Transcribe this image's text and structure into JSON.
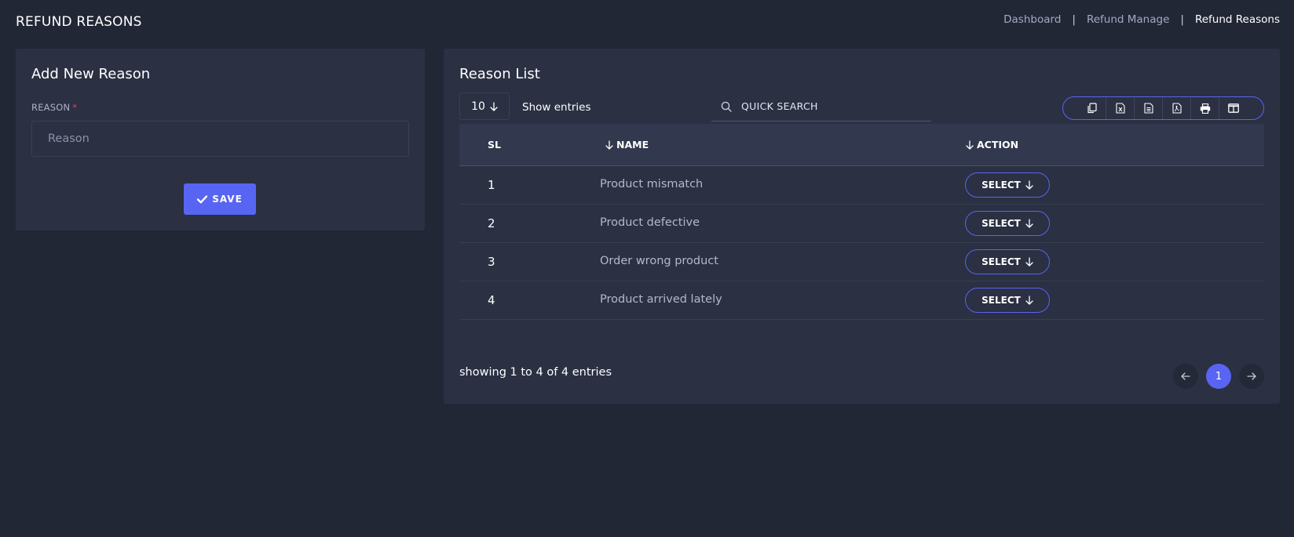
{
  "page": {
    "title": "REFUND REASONS"
  },
  "breadcrumb": {
    "items": [
      "Dashboard",
      "Refund Manage",
      "Refund Reasons"
    ],
    "separator": "|"
  },
  "form": {
    "title": "Add New Reason",
    "label": "REASON",
    "required_mark": "*",
    "placeholder": "Reason",
    "value": "",
    "save_label": "SAVE"
  },
  "list": {
    "title": "Reason List",
    "entries_value": "10",
    "show_entries_label": "Show entries",
    "search_placeholder": "QUICK SEARCH",
    "export_icons": [
      "copy-icon",
      "excel-icon",
      "csv-icon",
      "pdf-icon",
      "print-icon",
      "columns-icon"
    ],
    "columns": {
      "sl": "SL",
      "name": "NAME",
      "action": "ACTION"
    },
    "rows": [
      {
        "sl": "1",
        "name": "Product mismatch",
        "action": "SELECT"
      },
      {
        "sl": "2",
        "name": "Product defective",
        "action": "SELECT"
      },
      {
        "sl": "3",
        "name": "Order wrong product",
        "action": "SELECT"
      },
      {
        "sl": "4",
        "name": "Product arrived lately",
        "action": "SELECT"
      }
    ],
    "showing_text": "showing 1 to 4 of 4 entries",
    "current_page": "1"
  },
  "colors": {
    "background": "#222736",
    "card": "#2b3043",
    "accent": "#5865f2",
    "required": "#e0465e"
  }
}
